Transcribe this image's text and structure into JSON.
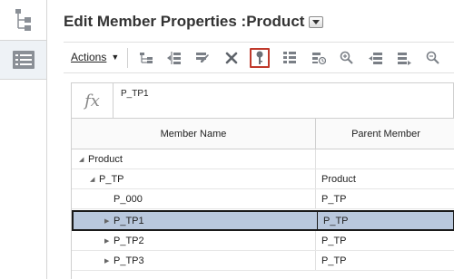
{
  "page": {
    "title": "Edit Member Properties :Product"
  },
  "toolbar": {
    "actions_label": "Actions",
    "icons": [
      "move-member-icon",
      "add-sibling-icon",
      "edit-member-icon",
      "delete-icon",
      "key-icon",
      "view-icon",
      "history-icon",
      "zoom-in-icon",
      "expand-icon",
      "collapse-icon",
      "search-icon"
    ],
    "selected_icon": "key-icon",
    "selected_color": "#c0392b"
  },
  "formula": {
    "fx_label": "fx",
    "value": "P_TP1"
  },
  "grid": {
    "columns": [
      "Member Name",
      "Parent Member"
    ],
    "rows": [
      {
        "name": "Product",
        "parent": "",
        "level": 0,
        "expander": "expanded",
        "selected": false
      },
      {
        "name": "P_TP",
        "parent": "Product",
        "level": 1,
        "expander": "expanded",
        "selected": false
      },
      {
        "name": "P_000",
        "parent": "P_TP",
        "level": 2,
        "expander": "leaf",
        "selected": false
      },
      {
        "name": "P_TP1",
        "parent": "P_TP",
        "level": 2,
        "expander": "collapsed",
        "selected": true
      },
      {
        "name": "P_TP2",
        "parent": "P_TP",
        "level": 2,
        "expander": "collapsed",
        "selected": false
      },
      {
        "name": "P_TP3",
        "parent": "P_TP",
        "level": 2,
        "expander": "collapsed",
        "selected": false
      }
    ],
    "selected_row_color": "#b9c8dd"
  }
}
